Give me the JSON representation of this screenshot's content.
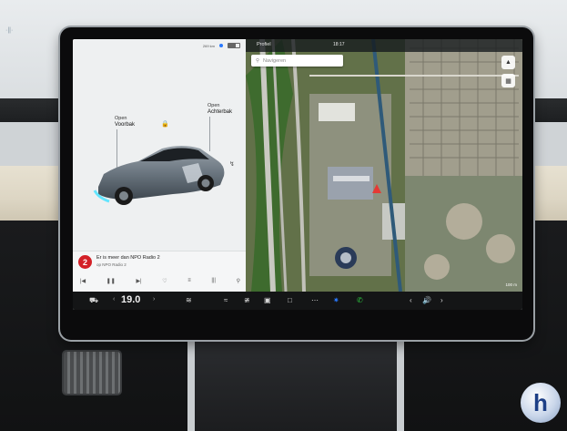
{
  "car_panel": {
    "status": {
      "range": "269 km",
      "clock": ""
    },
    "frunk_label": "Open",
    "frunk_name": "Voorbak",
    "trunk_label": "Open",
    "trunk_name": "Achterbak"
  },
  "media": {
    "title": "Er is meer dan NPO Radio 2",
    "subtitle": "op NPO Radio 2",
    "station_logo": "2"
  },
  "map": {
    "profile_label": "Profiel",
    "clock": "18:17",
    "search_placeholder": "Navigeren",
    "scale": "100 m"
  },
  "bottombar": {
    "temperature": "19.0"
  },
  "icons": {
    "lock": "lock-icon",
    "car": "car-icon",
    "bluetooth": "bluetooth-icon",
    "phone": "phone-icon",
    "volume": "volume-icon"
  },
  "colors": {
    "nav_arrow": "#e53935",
    "radio_brand": "#d32027",
    "phone_green": "#2ecc40",
    "bluetooth_blue": "#2979ff"
  }
}
